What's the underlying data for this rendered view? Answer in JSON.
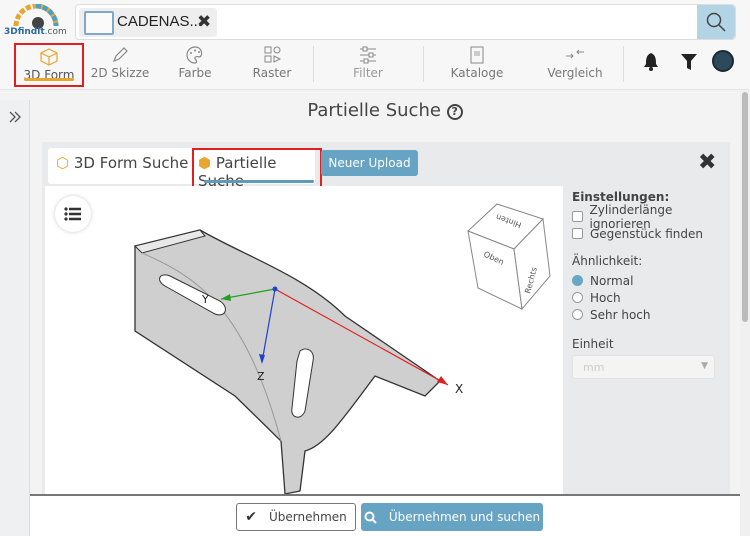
{
  "header": {
    "logo_text": "3Dfindit",
    "logo_suffix": ".com",
    "search_chip": "CADENAS...",
    "search_value": "",
    "icons": {
      "chip_close": "close-icon",
      "search": "search-icon"
    }
  },
  "toolbar": {
    "items": [
      {
        "label": "3D Form",
        "icon": "cube-icon",
        "active": true
      },
      {
        "label": "2D Skizze",
        "icon": "pencil-icon"
      },
      {
        "label": "Farbe",
        "icon": "palette-icon"
      },
      {
        "label": "Raster",
        "icon": "shapes-icon"
      },
      {
        "label": "Filter",
        "icon": "sliders-icon"
      },
      {
        "label": "Kataloge",
        "icon": "catalog-icon"
      },
      {
        "label": "Vergleich",
        "icon": "compare-icon"
      }
    ],
    "right_icons": [
      "bell-icon",
      "filter-icon",
      "avatar"
    ]
  },
  "page": {
    "title": "Partielle Suche",
    "help_icon": "question-circle-icon"
  },
  "tabs": [
    {
      "label": "3D Form Suche"
    },
    {
      "label": "Partielle Suche",
      "active": true
    }
  ],
  "upload_label": "Neuer Upload",
  "viewer": {
    "axes": {
      "x": "X",
      "y": "Y",
      "z": "Z"
    },
    "cube": {
      "top": "Hinten",
      "front": "Oben",
      "right": "Rechts"
    }
  },
  "settings": {
    "title": "Einstellungen:",
    "checkboxes": [
      {
        "label": "Zylinderlänge ignorieren",
        "checked": false
      },
      {
        "label": "Gegenstück finden",
        "checked": false
      }
    ],
    "similarity_label": "Ähnlichkeit:",
    "similarity_options": [
      {
        "label": "Normal",
        "selected": true
      },
      {
        "label": "Hoch"
      },
      {
        "label": "Sehr hoch"
      }
    ],
    "unit_label": "Einheit",
    "unit_value": "mm"
  },
  "footer": {
    "apply": "Übernehmen",
    "apply_search": "Übernehmen und suchen"
  },
  "colors": {
    "accent": "#67a3c2",
    "highlight": "#e02020",
    "active_underline": "#e8a630"
  }
}
